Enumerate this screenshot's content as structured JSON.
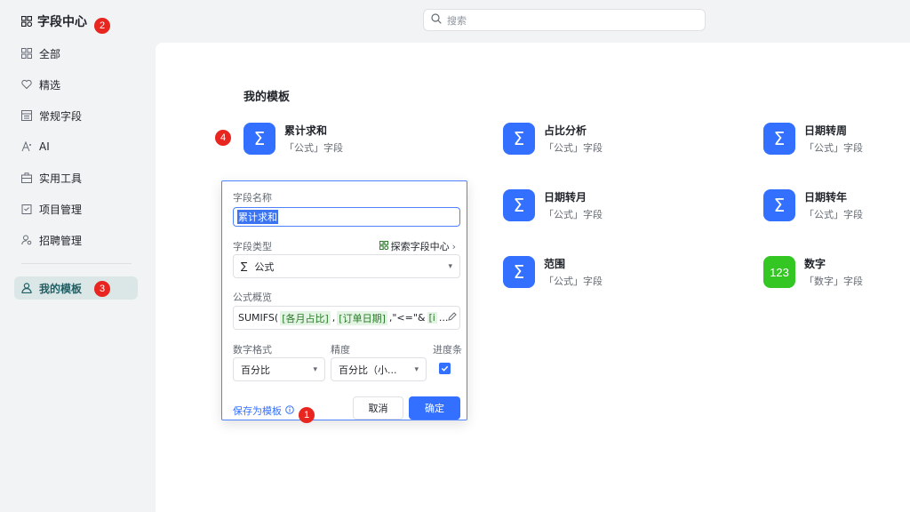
{
  "sidebar": {
    "title": "字段中心",
    "items": [
      {
        "label": "全部"
      },
      {
        "label": "精选"
      },
      {
        "label": "常规字段"
      },
      {
        "label": "AI"
      },
      {
        "label": "实用工具"
      },
      {
        "label": "项目管理"
      },
      {
        "label": "招聘管理"
      },
      {
        "label": "我的模板"
      }
    ]
  },
  "search": {
    "placeholder": "搜索"
  },
  "badges": {
    "b1": "1",
    "b2": "2",
    "b3": "3",
    "b4": "4"
  },
  "main": {
    "section_title": "我的模板",
    "cards": [
      {
        "title": "累计求和",
        "subtitle": "「公式」字段",
        "icon": "Σ"
      },
      {
        "title": "占比分析",
        "subtitle": "「公式」字段",
        "icon": "Σ"
      },
      {
        "title": "日期转周",
        "subtitle": "「公式」字段",
        "icon": "Σ"
      },
      {
        "title": "日期转月",
        "subtitle": "「公式」字段",
        "icon": "Σ"
      },
      {
        "title": "日期转年",
        "subtitle": "「公式」字段",
        "icon": "Σ"
      },
      {
        "title": "范围",
        "subtitle": "「公式」字段",
        "icon": "Σ"
      },
      {
        "title": "数字",
        "subtitle": "「数字」字段",
        "icon": "123"
      }
    ]
  },
  "popup": {
    "name_label": "字段名称",
    "name_value": "累计求和",
    "type_label": "字段类型",
    "explore_link": "探索字段中心",
    "type_value": "公式",
    "formula_label": "公式概览",
    "formula_prefix": "SUMIFS(",
    "formula_token1": "[各月占比]",
    "formula_sep": ",",
    "formula_token2": "[订单日期]",
    "formula_rest": ",\"<=\"&",
    "formula_token3": "[i",
    "formula_ellipsis": "...",
    "number_format_label": "数字格式",
    "number_format_value": "百分比",
    "precision_label": "精度",
    "precision_value": "百分比（小...",
    "progress_label": "进度条",
    "progress_checked": true,
    "save_template": "保存为模板",
    "cancel": "取消",
    "ok": "确定"
  },
  "colors": {
    "accent": "#3370ff",
    "active_nav_bg": "#dbe6e7",
    "badge": "#e8251f",
    "number_icon": "#34c724"
  }
}
